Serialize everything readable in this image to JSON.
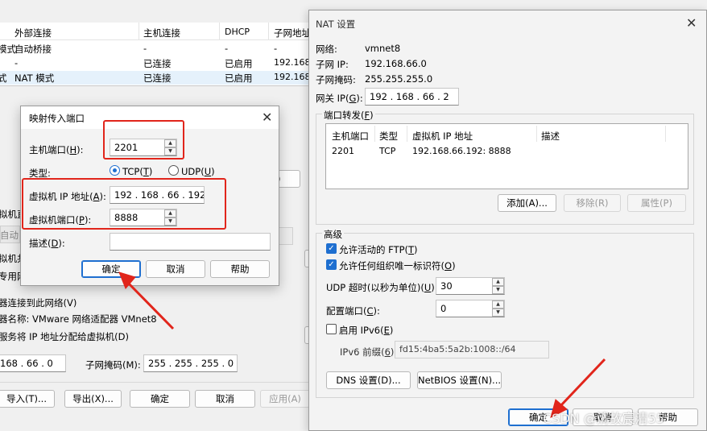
{
  "bg_window": {
    "table_headers": [
      "外部连接",
      "主机连接",
      "DHCP",
      "子网地址"
    ],
    "rows": [
      {
        "type": "模式",
        "ext": "自动桥接",
        "host": "-",
        "dhcp": "-",
        "subnet": "-"
      },
      {
        "type": "",
        "ext": "-",
        "host": "已连接",
        "dhcp": "已启用",
        "subnet": "192.168."
      },
      {
        "type": "式",
        "ext": "NAT 模式",
        "host": "已连接",
        "dhcp": "已启用",
        "subnet": "192.168."
      }
    ],
    "side_labels": [
      "拟机直",
      "自动",
      "拟机共",
      "专用网"
    ],
    "connect_host_check": "器连接到此网络(V)",
    "adapter_name": "器名称: VMware 网络适配器 VMnet8",
    "dhcp_check": "服务将 IP 地址分配给虚拟机(D)",
    "subnet_ip_value": "168 .  66  .  0",
    "subnet_mask_label": "子网掩码(M):",
    "subnet_mask_value": "255 . 255 . 255 .  0",
    "buttons": {
      "import": "导入(T)...",
      "export": "导出(X)...",
      "ok": "确定",
      "cancel": "取消",
      "apply": "应用(A)"
    }
  },
  "port_dialog": {
    "title": "映射传入端口",
    "host_port_label": "主机端口(H):",
    "host_port_value": "2201",
    "type_label": "类型:",
    "tcp_label": "TCP(T)",
    "udp_label": "UDP(U)",
    "vm_ip_label": "虚拟机 IP 地址(A):",
    "vm_ip_value": "192 . 168 .  66  . 192",
    "vm_port_label": "虚拟机端口(P):",
    "vm_port_value": "8888",
    "desc_label": "描述(D):",
    "desc_value": "",
    "ok": "确定",
    "cancel": "取消",
    "help": "帮助"
  },
  "nat_dialog": {
    "title": "NAT 设置",
    "network_label": "网络:",
    "network_value": "vmnet8",
    "subnet_ip_label": "子网 IP:",
    "subnet_ip_value": "192.168.66.0",
    "subnet_mask_label": "子网掩码:",
    "subnet_mask_value": "255.255.255.0",
    "gateway_label": "网关 IP(G):",
    "gateway_value": "192 . 168 .  66  .  2",
    "port_forward_group": "端口转发(F)",
    "pf_headers": [
      "主机端口",
      "类型",
      "虚拟机 IP 地址",
      "描述"
    ],
    "pf_rows": [
      {
        "port": "2201",
        "type": "TCP",
        "vm": "192.168.66.192: 8888",
        "desc": ""
      }
    ],
    "add_btn": "添加(A)...",
    "remove_btn": "移除(R)",
    "props_btn": "属性(P)",
    "advanced_group": "高级",
    "ftp_check": "允许活动的 FTP(T)",
    "uid_check": "允许任何组织唯一标识符(O)",
    "udp_timeout_label": "UDP 超时(以秒为单位)(U):",
    "udp_timeout_value": "30",
    "config_port_label": "配置端口(C):",
    "config_port_value": "0",
    "ipv6_check": "启用 IPv6(E)",
    "ipv6_prefix_label": "IPv6 前缀(6):",
    "ipv6_prefix_value": "fd15:4ba5:5a2b:1008::/64",
    "dns_btn": "DNS 设置(D)...",
    "netbios_btn": "NetBIOS 设置(N)...",
    "ok": "确定",
    "cancel": "取消",
    "help": "帮助"
  },
  "watermark": "CSDN @清故宸清55",
  "colors": {
    "annotation_red": "#e1251b",
    "accent_blue": "#1e6fd0"
  }
}
